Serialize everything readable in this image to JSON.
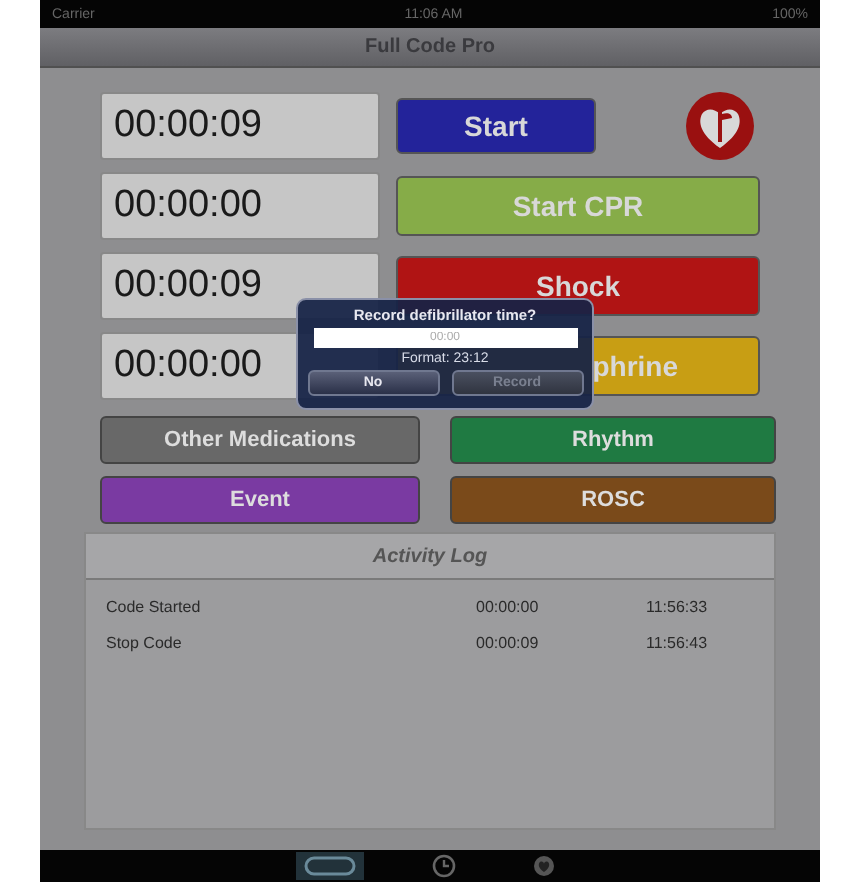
{
  "status_bar": {
    "carrier": "Carrier",
    "time": "11:06 AM",
    "battery": "100%"
  },
  "nav_bar": {
    "title": "Full Code Pro"
  },
  "timers": [
    {
      "time": "00:00:09",
      "button": {
        "label": "Start",
        "color": "#23239a"
      },
      "logo": true
    },
    {
      "time": "00:00:00",
      "button": {
        "label": "Start CPR",
        "color": "#86ac48"
      }
    },
    {
      "time": "00:00:09",
      "button": {
        "label": "Shock",
        "color": "#b01414"
      }
    },
    {
      "time": "00:00:00",
      "button": {
        "label": "phrine",
        "color": "#c89e14"
      }
    }
  ],
  "actions": [
    {
      "label": "Other Medications",
      "color": "#686868"
    },
    {
      "label": "Rhythm",
      "color": "#1f7a42"
    },
    {
      "label": "Event",
      "color": "#7a3aa2"
    },
    {
      "label": "ROSC",
      "color": "#7a4a1a"
    }
  ],
  "activity_log": {
    "title": "Activity Log",
    "entries": [
      {
        "event": "Code Started",
        "elapsed": "00:00:00",
        "time": "11:56:33"
      },
      {
        "event": "Stop Code",
        "elapsed": "00:00:09",
        "time": "11:56:43"
      }
    ]
  },
  "dialog": {
    "title": "Record defibrillator time?",
    "field": {
      "placeholder": "00:00"
    },
    "hint": "Format: 23:12",
    "buttons": [
      {
        "label": "No",
        "disabled": false
      },
      {
        "label": "Record",
        "disabled": true
      }
    ]
  },
  "tab_bar": [
    {
      "kind": "card",
      "selected": true
    },
    {
      "kind": "clock",
      "selected": false
    },
    {
      "kind": "heart",
      "selected": false
    }
  ]
}
